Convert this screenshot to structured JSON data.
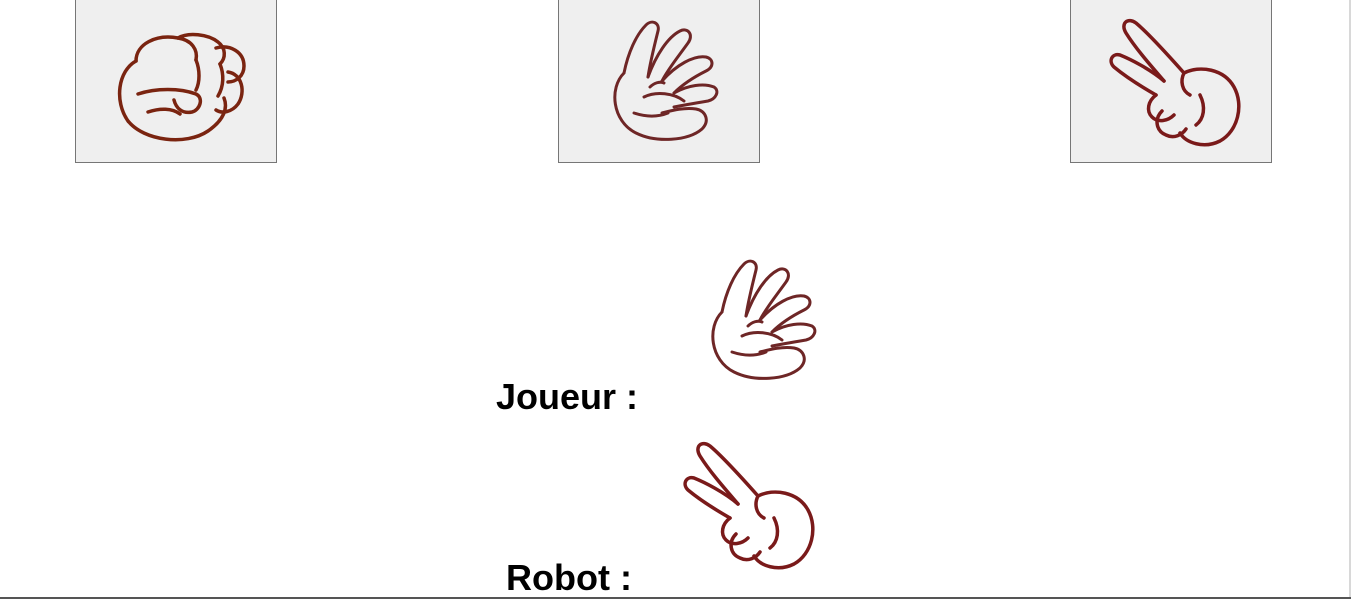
{
  "choices": [
    {
      "id": "rock",
      "icon": "rock-fist-icon"
    },
    {
      "id": "paper",
      "icon": "paper-hand-icon"
    },
    {
      "id": "scissors",
      "icon": "scissors-hand-icon"
    }
  ],
  "player": {
    "label": "Joueur :",
    "choice": "paper",
    "icon": "paper-hand-icon"
  },
  "robot": {
    "label": "Robot :",
    "choice": "scissors",
    "icon": "scissors-hand-icon"
  },
  "colors": {
    "button_bg": "#efefef",
    "button_border": "#767676",
    "rock_stroke": "#7a2410",
    "paper_stroke": "#6e2626",
    "scissors_stroke": "#7a1a1a"
  }
}
